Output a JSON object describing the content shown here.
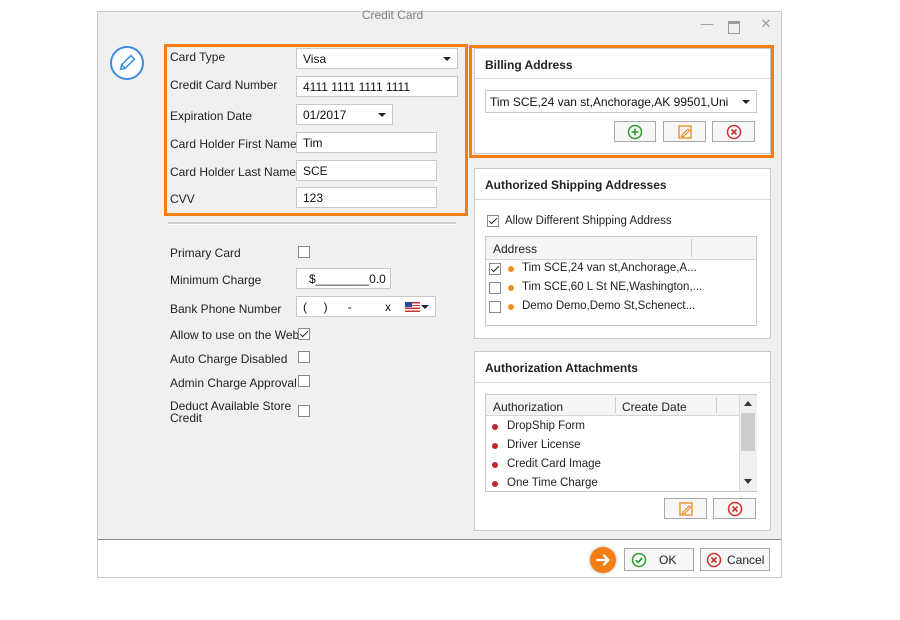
{
  "window": {
    "title": "Credit Card"
  },
  "card_form": {
    "card_type_label": "Card Type",
    "card_type_value": "Visa",
    "card_number_label": "Credit Card Number",
    "card_number_value": "4111 1111 1111 1111",
    "expiration_label": "Expiration Date",
    "expiration_value": "01/2017",
    "first_name_label": "Card Holder First Name",
    "first_name_value": "Tim",
    "last_name_label": "Card Holder Last Name",
    "last_name_value": "SCE",
    "cvv_label": "CVV",
    "cvv_value": "123"
  },
  "options": {
    "primary_card_label": "Primary Card",
    "primary_card_checked": false,
    "minimum_charge_label": "Minimum Charge",
    "minimum_charge_value": "$________0.0",
    "bank_phone_label": "Bank Phone Number",
    "bank_phone_value": "(     )      -          x",
    "allow_web_label": "Allow to use on the Web",
    "allow_web_checked": true,
    "auto_charge_label": "Auto Charge Disabled",
    "auto_charge_checked": false,
    "admin_approval_label": "Admin Charge Approval",
    "admin_approval_checked": false,
    "deduct_credit_label_line1": "Deduct Available Store",
    "deduct_credit_label_line2": "Credit",
    "deduct_credit_checked": false
  },
  "billing": {
    "title": "Billing Address",
    "selected": "Tim SCE,24 van st,Anchorage,AK 99501,Uni"
  },
  "shipping": {
    "title": "Authorized Shipping Addresses",
    "allow_different_label": "Allow Different Shipping Address",
    "allow_different_checked": true,
    "column_address": "Address",
    "rows": [
      {
        "text": "Tim SCE,24 van st,Anchorage,A...",
        "checked": true
      },
      {
        "text": "Tim SCE,60 L St NE,Washington,...",
        "checked": false
      },
      {
        "text": "Demo Demo,Demo St,Schenect...",
        "checked": false
      }
    ]
  },
  "attachments": {
    "title": "Authorization Attachments",
    "column_authorization": "Authorization",
    "column_create_date": "Create Date",
    "rows": [
      "DropShip Form",
      "Driver License",
      "Credit Card Image",
      "One Time Charge"
    ]
  },
  "footer": {
    "ok_label": "OK",
    "cancel_label": "Cancel"
  },
  "colors": {
    "highlight": "#f57e12",
    "accent_blue": "#3a8ee0",
    "add_green": "#2a9d2a",
    "delete_red": "#d23030",
    "bullet_orange": "#f0901e",
    "bullet_red": "#c0282f"
  }
}
